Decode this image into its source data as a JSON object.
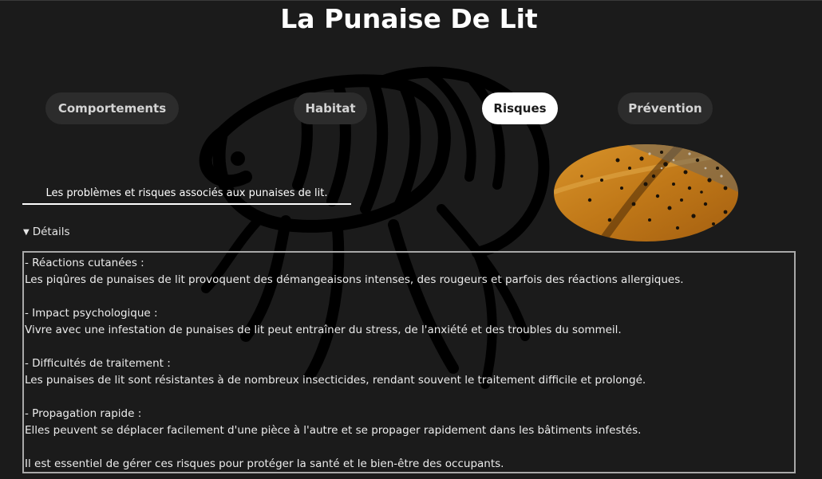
{
  "page": {
    "title": "La Punaise De Lit"
  },
  "nav": {
    "items": [
      {
        "label": "Comportements",
        "active": false
      },
      {
        "label": "Habitat",
        "active": false
      },
      {
        "label": "Risques",
        "active": true
      },
      {
        "label": "Prévention",
        "active": false
      }
    ]
  },
  "section": {
    "subtitle": "Les problèmes et risques associés aux punaises de lit.",
    "summary_icon": "disclosure-triangle-down-icon",
    "summary_label": "Détails",
    "image_icon": "bedbug-infestation-photo",
    "watermark_icon": "bedbug-outline-icon"
  },
  "details": {
    "reactions_title": "- Réactions cutanées :",
    "reactions_text": "Les piqûres de punaises de lit provoquent des démangeaisons intenses, des rougeurs et parfois des réactions allergiques.",
    "psych_title": "- Impact psychologique :",
    "psych_text": "Vivre avec une infestation de punaises de lit peut entraîner du stress, de l'anxiété et des troubles du sommeil.",
    "treatment_title": "- Difficultés de traitement :",
    "treatment_text": "Les punaises de lit sont résistantes à de nombreux insecticides, rendant souvent le traitement difficile et prolongé.",
    "spread_title": "- Propagation rapide :",
    "spread_text": "Elles peuvent se déplacer facilement d'une pièce à l'autre et se propager rapidement dans les bâtiments infestés.",
    "conclusion": "Il est essentiel de gérer ces risques pour protéger la santé et le bien-être des occupants."
  },
  "colors": {
    "background": "#1b1b1b",
    "button": "#2c2c2c",
    "button_active": "#ffffff",
    "text": "#ffffff",
    "border": "#a8a8a8",
    "wood": "#c8841f"
  }
}
